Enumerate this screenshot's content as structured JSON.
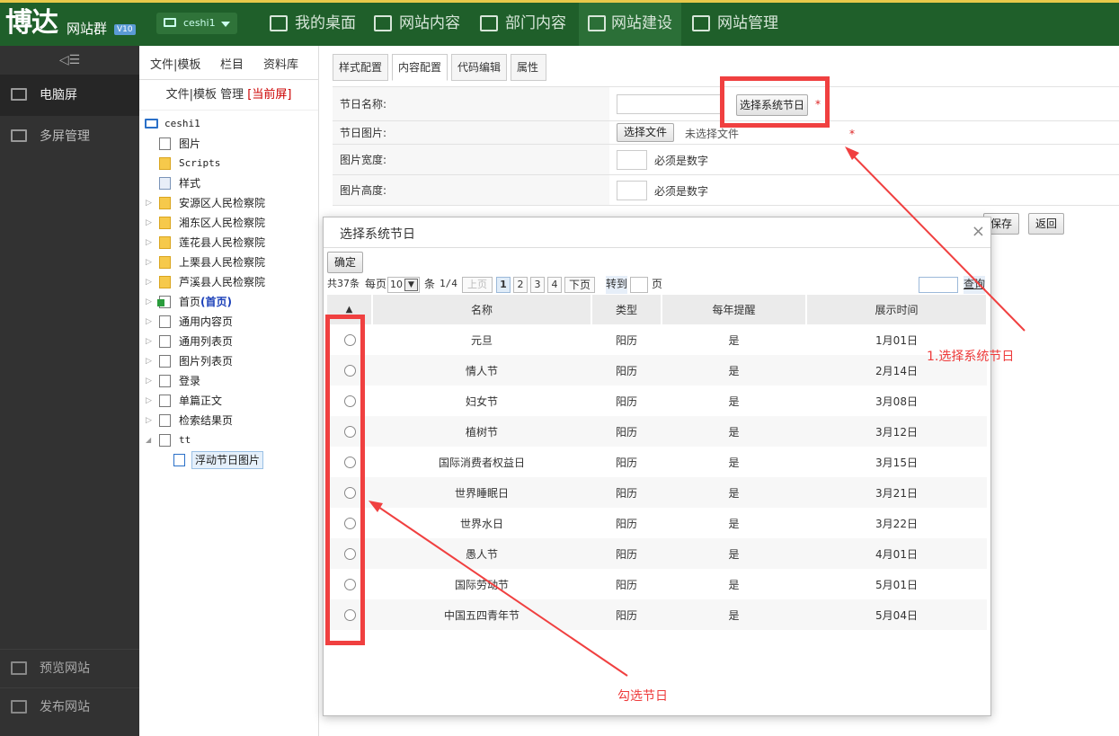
{
  "header": {
    "logo": "博达",
    "subtitle": "网站群",
    "version": "V10",
    "site": "ceshi1",
    "nav": [
      {
        "label": "我的桌面",
        "icon": "grid-icon"
      },
      {
        "label": "网站内容",
        "icon": "edit-icon"
      },
      {
        "label": "部门内容",
        "icon": "org-icon"
      },
      {
        "label": "网站建设",
        "icon": "build-icon",
        "active": true
      },
      {
        "label": "网站管理",
        "icon": "monitor-gear-icon"
      }
    ]
  },
  "sidebar": {
    "collapse": "◁☰",
    "items": [
      {
        "label": "电脑屏",
        "active": true
      },
      {
        "label": "多屏管理"
      }
    ],
    "bottom": [
      {
        "label": "预览网站"
      },
      {
        "label": "发布网站"
      }
    ]
  },
  "tree_panel": {
    "tabs": [
      "文件|模板",
      "栏目",
      "资料库"
    ],
    "sub_prefix": "文件|模板 管理",
    "sub_current": "[当前屏]",
    "nodes": [
      {
        "label": "ceshi1"
      },
      {
        "label": "图片"
      },
      {
        "label": "Scripts"
      },
      {
        "label": "样式"
      },
      {
        "label": "安源区人民检察院"
      },
      {
        "label": "湘东区人民检察院"
      },
      {
        "label": "莲花县人民检察院"
      },
      {
        "label": "上栗县人民检察院"
      },
      {
        "label": "芦溪县人民检察院"
      },
      {
        "label": "首页",
        "tag": "(首页)"
      },
      {
        "label": "通用内容页"
      },
      {
        "label": "通用列表页"
      },
      {
        "label": "图片列表页"
      },
      {
        "label": "登录"
      },
      {
        "label": "单篇正文"
      },
      {
        "label": "检索结果页"
      },
      {
        "label": "tt"
      },
      {
        "label": "浮动节日图片"
      }
    ]
  },
  "main": {
    "tabs": [
      "样式配置",
      "内容配置",
      "代码编辑",
      "属性"
    ],
    "form": {
      "festival_name_label": "节日名称:",
      "select_festival_btn": "选择系统节日",
      "festival_image_label": "节日图片:",
      "choose_file_btn": "选择文件",
      "no_file": "未选择文件",
      "width_label": "图片宽度:",
      "height_label": "图片高度:",
      "must_number": "必须是数字",
      "required": "*",
      "save_btn": "保存",
      "back_btn": "返回"
    }
  },
  "modal": {
    "title": "选择系统节日",
    "close": "×",
    "confirm_btn": "确定",
    "pager": {
      "total": "共37条",
      "per_page_label": "每页",
      "per_page": "10",
      "unit": "条",
      "page_info": "1/4",
      "prev": "上页",
      "pages": [
        "1",
        "2",
        "3",
        "4"
      ],
      "next": "下页",
      "goto": "转到",
      "page_unit": "页",
      "query_btn": "查询"
    },
    "columns": [
      "▲",
      "名称",
      "类型",
      "每年提醒",
      "展示时间"
    ],
    "rows": [
      [
        "元旦",
        "阳历",
        "是",
        "1月01日"
      ],
      [
        "情人节",
        "阳历",
        "是",
        "2月14日"
      ],
      [
        "妇女节",
        "阳历",
        "是",
        "3月08日"
      ],
      [
        "植树节",
        "阳历",
        "是",
        "3月12日"
      ],
      [
        "国际消费者权益日",
        "阳历",
        "是",
        "3月15日"
      ],
      [
        "世界睡眠日",
        "阳历",
        "是",
        "3月21日"
      ],
      [
        "世界水日",
        "阳历",
        "是",
        "3月22日"
      ],
      [
        "愚人节",
        "阳历",
        "是",
        "4月01日"
      ],
      [
        "国际劳动节",
        "阳历",
        "是",
        "5月01日"
      ],
      [
        "中国五四青年节",
        "阳历",
        "是",
        "5月04日"
      ]
    ]
  },
  "annotations": {
    "step1": "1.选择系统节日",
    "step2": "勾选节日",
    "color": "#f04040"
  }
}
